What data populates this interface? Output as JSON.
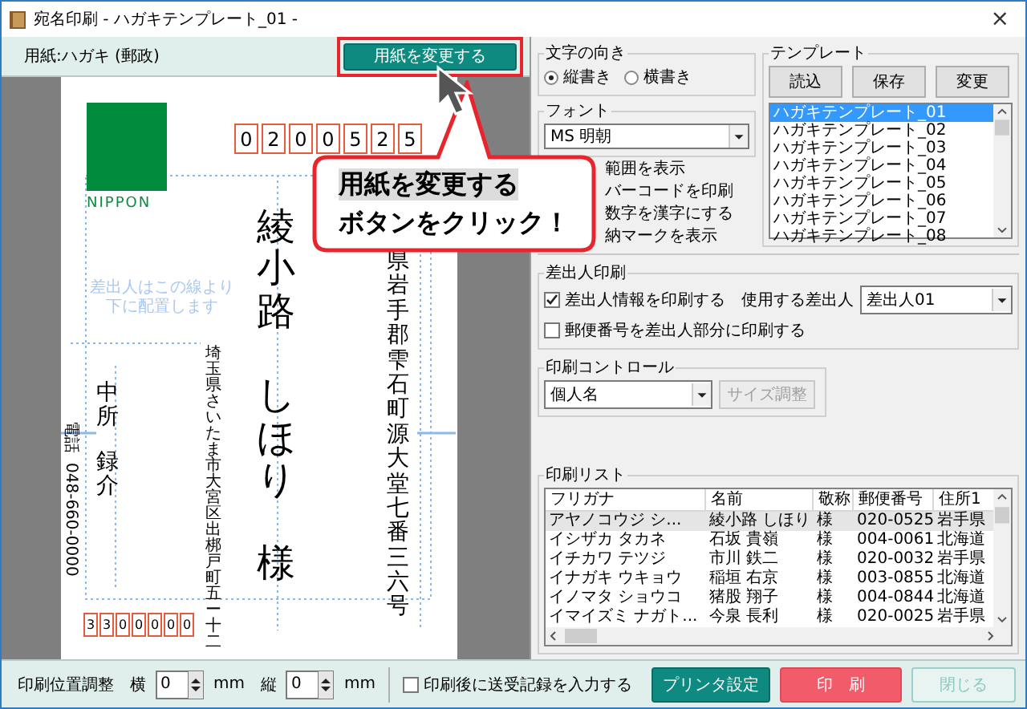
{
  "window": {
    "title": "宛名印刷 - ハガキテンプレート_01 -",
    "close": "×"
  },
  "paper_bar": {
    "label": "用紙:ハガキ (郵政)",
    "button": "用紙を変更する"
  },
  "postcard": {
    "logo_text": "NIPPON",
    "recipient_zip": [
      "0",
      "2",
      "0",
      "0",
      "5",
      "2",
      "5"
    ],
    "recipient_address": "県岩手郡雫石町源大堂七番三六号",
    "recipient_name": [
      "綾小路",
      "しほり"
    ],
    "honorific": "様",
    "sender_guide": "差出人はこの線より下に配置します",
    "sender_address": "埼玉県さいたま市大宮区出梆戸町五ー十二",
    "sender_name": [
      "中所",
      "録介"
    ],
    "phone_label": "電話",
    "phone": "048-660-0000",
    "sender_zip": [
      "3",
      "3",
      "0",
      "0",
      "0",
      "0",
      "0"
    ]
  },
  "callout": {
    "lines": [
      "用紙を変更する",
      "ボタンをクリック！"
    ]
  },
  "orientation": {
    "label": "文字の向き",
    "options": [
      {
        "label": "縦書き",
        "selected": true
      },
      {
        "label": "横書き",
        "selected": false
      }
    ]
  },
  "font": {
    "label": "フォント",
    "value": "MS 明朝"
  },
  "display_options": [
    "範囲を表示",
    "バーコードを印刷",
    "数字を漢字にする",
    "納マークを表示"
  ],
  "template": {
    "label": "テンプレート",
    "buttons": [
      "読込",
      "保存",
      "変更"
    ],
    "items": [
      {
        "label": "ハガキテンプレート_01",
        "selected": true
      },
      {
        "label": "ハガキテンプレート_02",
        "selected": false
      },
      {
        "label": "ハガキテンプレート_03",
        "selected": false
      },
      {
        "label": "ハガキテンプレート_04",
        "selected": false
      },
      {
        "label": "ハガキテンプレート_05",
        "selected": false
      },
      {
        "label": "ハガキテンプレート_06",
        "selected": false
      },
      {
        "label": "ハガキテンプレート_07",
        "selected": false
      },
      {
        "label": "ハガキテンプレート_08",
        "selected": false
      }
    ]
  },
  "sender_print": {
    "label": "差出人印刷",
    "print_sender": {
      "label": "差出人情報を印刷する",
      "checked": true
    },
    "sender_select_label": "使用する差出人",
    "sender_select": "差出人01",
    "print_zip": {
      "label": "郵便番号を差出人部分に印刷する",
      "checked": false
    }
  },
  "print_control": {
    "label": "印刷コントロール",
    "select": "個人名",
    "button": {
      "label": "サイズ調整",
      "disabled": true
    }
  },
  "print_list": {
    "label": "印刷リスト",
    "columns": [
      "フリガナ",
      "名前",
      "敬称",
      "郵便番号",
      "住所1"
    ],
    "rows": [
      {
        "cells": [
          "アヤノコウジ シ...",
          "綾小路 しほり",
          "様",
          "020-0525",
          "岩手県"
        ],
        "selected": true
      },
      {
        "cells": [
          "イシザカ タカネ",
          "石坂 貴嶺",
          "様",
          "004-0061",
          "北海道"
        ],
        "selected": false
      },
      {
        "cells": [
          "イチカワ テツジ",
          "市川 鉄二",
          "様",
          "020-0032",
          "岩手県"
        ],
        "selected": false
      },
      {
        "cells": [
          "イナガキ ウキョウ",
          "稲垣 右京",
          "様",
          "003-0855",
          "北海道"
        ],
        "selected": false
      },
      {
        "cells": [
          "イノマタ ショウコ",
          "猪股 翔子",
          "様",
          "004-0844",
          "北海道"
        ],
        "selected": false
      },
      {
        "cells": [
          "イマイズミ ナガト...",
          "今泉 長利",
          "様",
          "020-0025",
          "岩手県"
        ],
        "selected": false
      }
    ]
  },
  "bottom": {
    "position_label": "印刷位置調整",
    "offsets": [
      {
        "label": "横",
        "value": "0",
        "unit": "mm"
      },
      {
        "label": "縦",
        "value": "0",
        "unit": "mm"
      }
    ],
    "record": {
      "label": "印刷後に送受記録を入力する",
      "checked": false
    },
    "buttons": [
      {
        "label": "プリンタ設定",
        "kind": "primary"
      },
      {
        "label": "印　刷",
        "kind": "print"
      },
      {
        "label": "閉じる",
        "kind": "close"
      }
    ]
  }
}
